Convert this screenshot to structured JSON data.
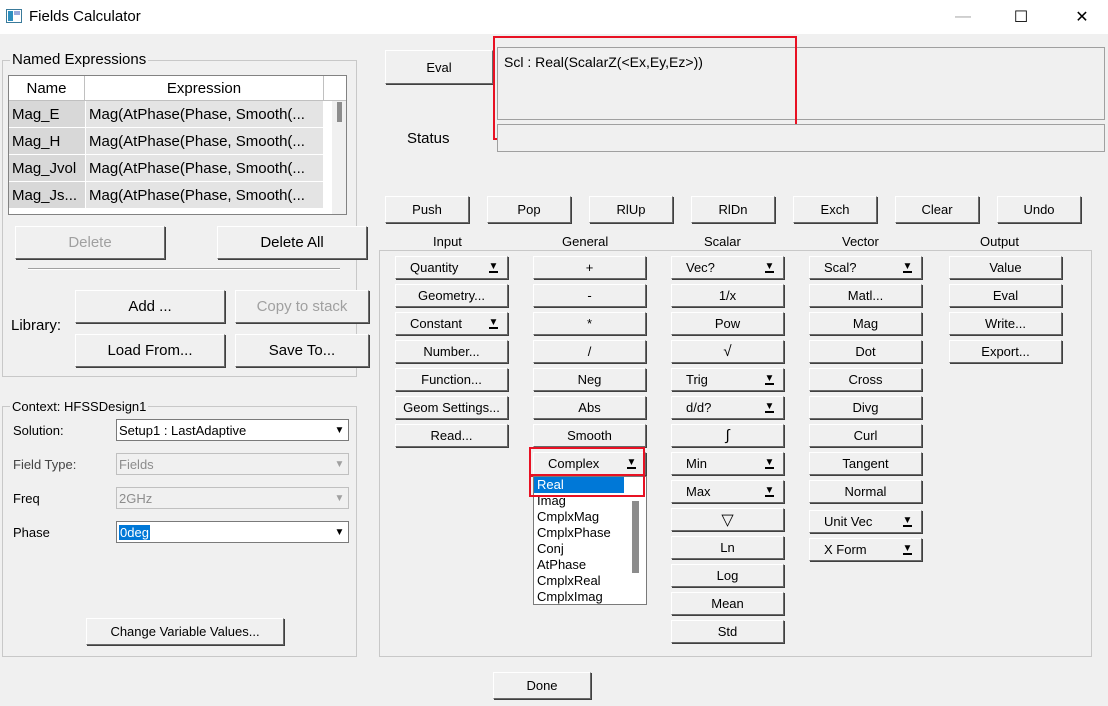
{
  "window": {
    "title": "Fields Calculator",
    "controls": {
      "minimize": "—",
      "maximize": "☐",
      "close": "✕"
    }
  },
  "named_expressions": {
    "label": "Named Expressions",
    "columns": [
      "Name",
      "Expression"
    ],
    "rows": [
      {
        "name": "Mag_E",
        "expression": "Mag(AtPhase(Phase, Smooth(..."
      },
      {
        "name": "Mag_H",
        "expression": "Mag(AtPhase(Phase, Smooth(..."
      },
      {
        "name": "Mag_Jvol",
        "expression": "Mag(AtPhase(Phase, Smooth(..."
      },
      {
        "name": "Mag_Js...",
        "expression": "Mag(AtPhase(Phase, Smooth(..."
      }
    ],
    "delete_label": "Delete",
    "delete_all_label": "Delete All",
    "library_label": "Library:",
    "add_label": "Add ...",
    "copy_to_stack_label": "Copy to stack",
    "load_from_label": "Load From...",
    "save_to_label": "Save To..."
  },
  "context": {
    "label": "Context: HFSSDesign1",
    "solution_label": "Solution:",
    "solution_value": "Setup1 : LastAdaptive",
    "field_type_label": "Field Type:",
    "field_type_value": "Fields",
    "freq_label": "Freq",
    "freq_value": "2GHz",
    "phase_label": "Phase",
    "phase_value": "0deg",
    "change_vars_label": "Change Variable Values..."
  },
  "stack": {
    "eval_label": "Eval",
    "status_label": "Status",
    "top_expression": "Scl : Real(ScalarZ(<Ex,Ey,Ez>))",
    "highlight_color": "#e81123"
  },
  "stack_buttons": [
    "Push",
    "Pop",
    "RlUp",
    "RlDn",
    "Exch",
    "Clear",
    "Undo"
  ],
  "sections": {
    "input": "Input",
    "general": "General",
    "scalar": "Scalar",
    "vector": "Vector",
    "output": "Output"
  },
  "input_buttons": [
    "Quantity",
    "Geometry...",
    "Constant",
    "Number...",
    "Function...",
    "Geom Settings...",
    "Read..."
  ],
  "general_buttons": [
    "+",
    "-",
    "*",
    "/",
    "Neg",
    "Abs",
    "Smooth"
  ],
  "complex": {
    "label": "Complex",
    "options": [
      "Real",
      "Imag",
      "CmplxMag",
      "CmplxPhase",
      "Conj",
      "AtPhase",
      "CmplxReal",
      "CmplxImag"
    ]
  },
  "scalar_buttons": [
    "Vec?",
    "1/x",
    "Pow",
    "√",
    "Trig",
    "d/d?",
    "∫",
    "Min",
    "Max",
    "▽",
    "Ln",
    "Log",
    "Mean",
    "Std"
  ],
  "vector_buttons": [
    "Scal?",
    "Matl...",
    "Mag",
    "Dot",
    "Cross",
    "Divg",
    "Curl",
    "Tangent",
    "Normal",
    "Unit Vec",
    "X Form"
  ],
  "output_buttons": [
    "Value",
    "Eval",
    "Write...",
    "Export..."
  ],
  "done_label": "Done"
}
